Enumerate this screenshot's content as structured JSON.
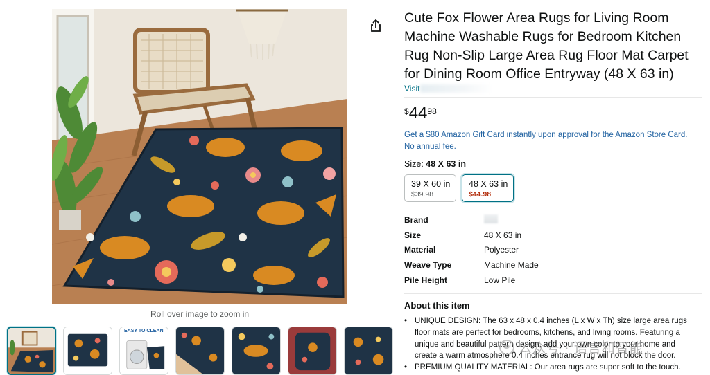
{
  "product": {
    "title": "Cute Fox Flower Area Rugs for Living Room Machine Washable Rugs for Bedroom Kitchen Rug Non-Slip Large Area Rug Floor Mat Carpet for Dining Room Office Entryway (48 X 63 in)",
    "visit_prefix": "Visit",
    "price": {
      "symbol": "$",
      "whole": "44",
      "fraction": "98"
    },
    "promo": "Get a $80 Amazon Gift Card instantly upon approval for the Amazon Store Card. No annual fee."
  },
  "gallery": {
    "zoom_hint": "Roll over image to zoom in",
    "thumbnail_badge": "EASY TO CLEAN",
    "thumbnail_count": 7,
    "selected_index": 0
  },
  "size": {
    "label": "Size:",
    "selected": "48 X 63 in",
    "options": [
      {
        "label": "39 X 60 in",
        "price": "$39.98",
        "selected": false
      },
      {
        "label": "48 X 63 in",
        "price": "$44.98",
        "selected": true
      }
    ]
  },
  "specs": [
    {
      "key": "Brand",
      "value": ""
    },
    {
      "key": "Size",
      "value": "48 X 63 in"
    },
    {
      "key": "Material",
      "value": "Polyester"
    },
    {
      "key": "Weave Type",
      "value": "Machine Made"
    },
    {
      "key": "Pile Height",
      "value": "Low Pile"
    }
  ],
  "about": {
    "title": "About this item",
    "bullets": [
      "UNIQUE DESIGN: The 63 x 48 x 0.4 inches (L x W x Th) size large area rugs floor mats are perfect for bedrooms, kitchens, and living rooms. Featuring a unique and beautiful pattern design, add your own color to your home and create a warm atmosphere 0.4 inches entrance rug will not block the door.",
      "PREMIUM QUALITY MATERIAL: Our area rugs are super soft to the touch."
    ]
  },
  "watermark": {
    "text": "公众号 · 语言和智能"
  },
  "colors": {
    "link": "#007185",
    "promo": "#2162a1",
    "deal_price": "#b12704",
    "rug_navy": "#1f3346",
    "fox_orange": "#d98a22"
  },
  "icons": {
    "share": "share-icon"
  }
}
